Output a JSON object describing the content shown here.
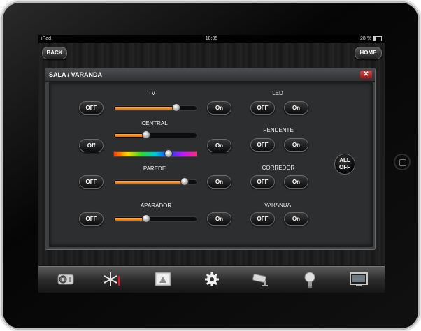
{
  "status": {
    "carrier": "iPad",
    "time": "18:05",
    "battery": "28 %"
  },
  "nav": {
    "back_label": "BACK",
    "home_label": "HOME"
  },
  "panel": {
    "title": "SALA / VARANDA",
    "close_label": "✕"
  },
  "dimmers": [
    {
      "label": "TV",
      "off_label": "OFF",
      "on_label": "On",
      "level": 0.75
    },
    {
      "label": "CENTRAL",
      "off_label": "Off",
      "on_label": "On",
      "level": 0.38,
      "color_position": 0.66
    },
    {
      "label": "PAREDE",
      "off_label": "OFF",
      "on_label": "On",
      "level": 0.85
    },
    {
      "label": "APARADOR",
      "off_label": "OFF",
      "on_label": "On",
      "level": 0.38
    }
  ],
  "switches": [
    {
      "label": "LED",
      "off_label": "OFF",
      "on_label": "On"
    },
    {
      "label": "PENDENTE",
      "off_label": "OFF",
      "on_label": "On"
    },
    {
      "label": "CORREDOR",
      "off_label": "OFF",
      "on_label": "On"
    },
    {
      "label": "VARANDA",
      "off_label": "OFF",
      "on_label": "On"
    }
  ],
  "all_off": {
    "line1": "ALL",
    "line2": "OFF"
  },
  "tabs": [
    {
      "icon": "camera-audio-icon"
    },
    {
      "icon": "climate-snowflake-icon"
    },
    {
      "icon": "projector-screen-icon"
    },
    {
      "icon": "settings-gear-icon"
    },
    {
      "icon": "security-camera-icon"
    },
    {
      "icon": "light-bulb-icon"
    },
    {
      "icon": "tv-display-icon"
    }
  ],
  "colors": {
    "accent_orange": "#f08a12",
    "close_red": "#c52a2a"
  }
}
